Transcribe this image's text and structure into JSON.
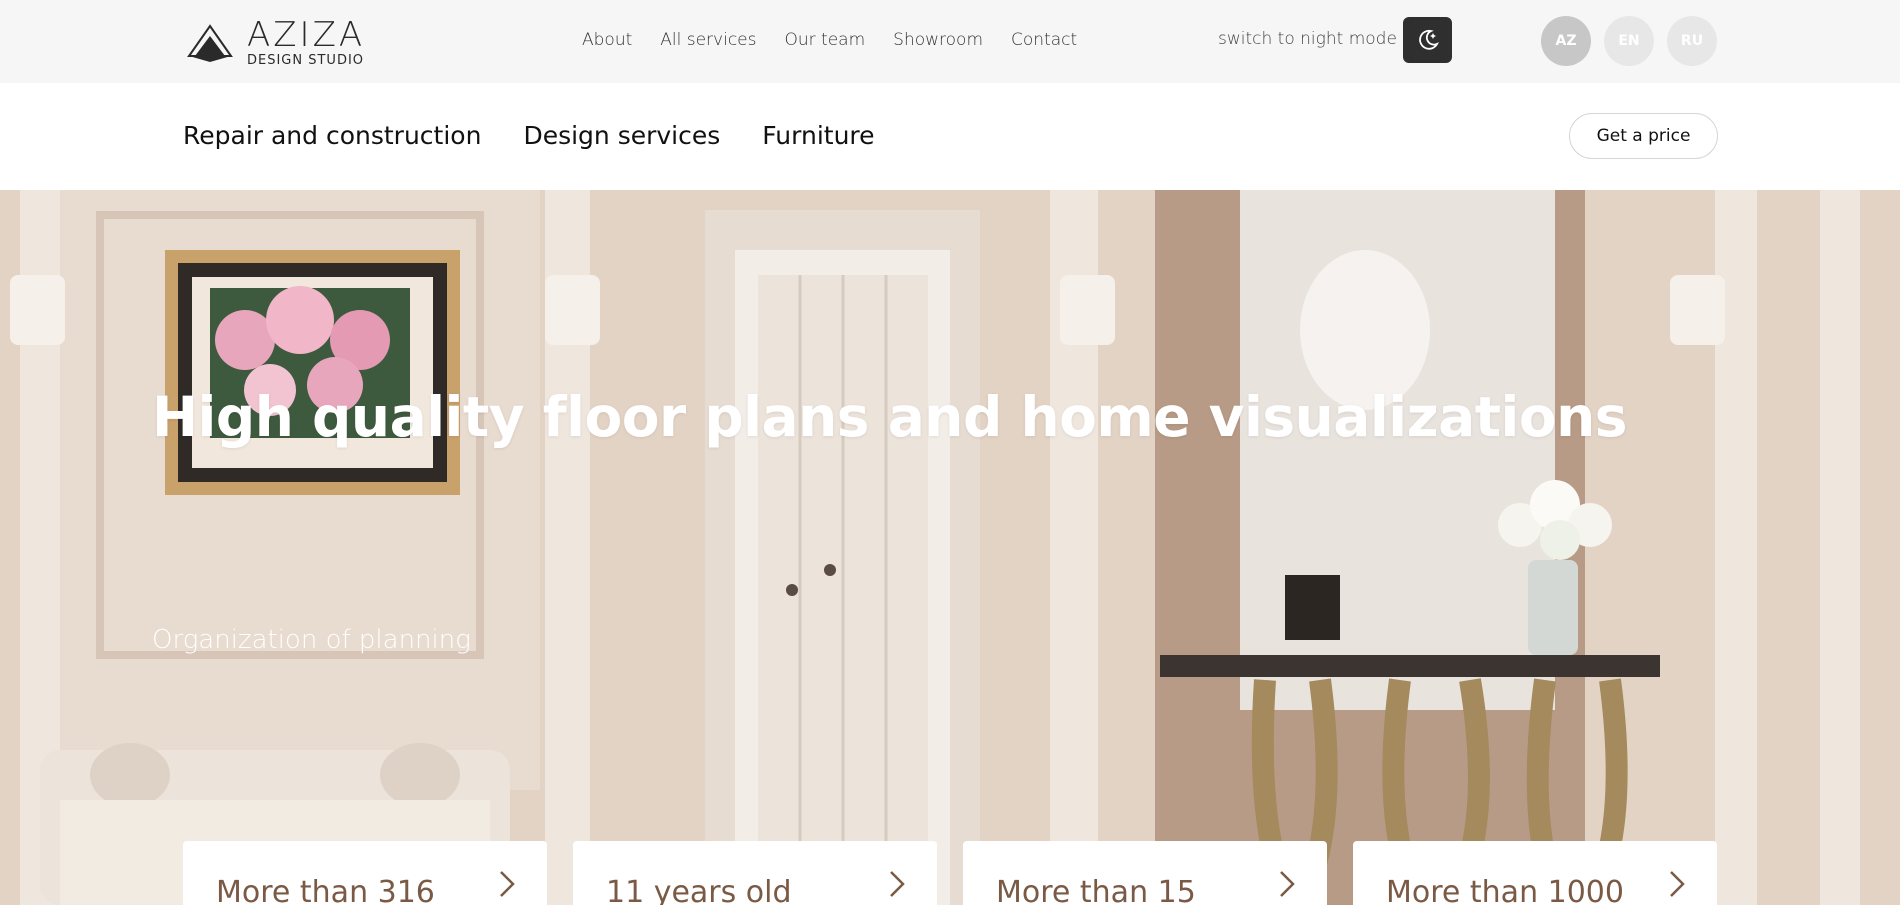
{
  "header": {
    "logo": {
      "name": "AZIZA",
      "subtitle": "DESIGN STUDIO"
    },
    "nav": [
      "About",
      "All services",
      "Our team",
      "Showroom",
      "Contact"
    ],
    "night_mode_label": "switch to night mode",
    "languages": [
      {
        "code": "AZ",
        "active": true
      },
      {
        "code": "EN",
        "active": false
      },
      {
        "code": "RU",
        "active": false
      }
    ]
  },
  "subnav": {
    "items": [
      "Repair and construction",
      "Design services",
      "Furniture"
    ],
    "cta": "Get a price"
  },
  "hero": {
    "title": "High quality floor plans and home visualizations",
    "subtitle": "Organization of planning",
    "cards": [
      "More than 316",
      "11 years old",
      "More than 15",
      "More than 1000"
    ]
  },
  "colors": {
    "accent_text": "#7a5a45",
    "night_button": "#2f2f2f",
    "topbar_bg": "#f6f6f6"
  },
  "icons": {
    "night": "moon-icon",
    "card_arrow": "chevron-right-icon"
  }
}
